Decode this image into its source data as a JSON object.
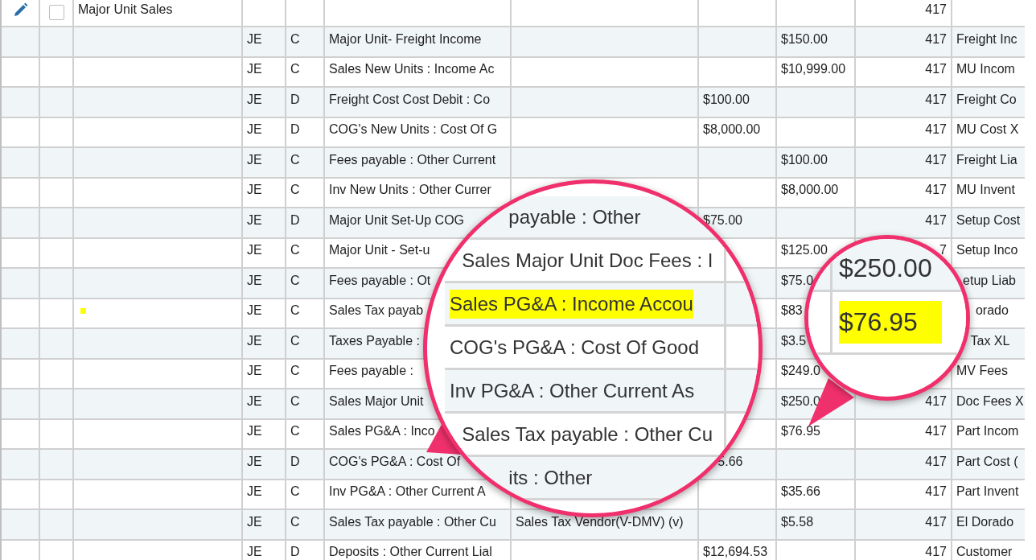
{
  "rows": [
    {
      "kind": "group",
      "name": "Major Unit Sales",
      "checked": false,
      "num": "417"
    },
    {
      "kind": "entry",
      "type": "JE",
      "dc": "C",
      "account": "Major Unit- Freight Income",
      "credit": "$150.00",
      "num": "417",
      "memo": "Freight Inc",
      "marked": false
    },
    {
      "kind": "entry",
      "type": "JE",
      "dc": "C",
      "account": "Sales New Units : Income Ac",
      "credit": "$10,999.00",
      "num": "417",
      "memo": "MU Incom",
      "marked": false
    },
    {
      "kind": "entry",
      "type": "JE",
      "dc": "D",
      "account": "Freight Cost Cost Debit : Co",
      "debit": "$100.00",
      "num": "417",
      "memo": "Freight Co",
      "marked": false
    },
    {
      "kind": "entry",
      "type": "JE",
      "dc": "D",
      "account": "COG's New Units : Cost Of G",
      "debit": "$8,000.00",
      "num": "417",
      "memo": "MU Cost X",
      "marked": false
    },
    {
      "kind": "entry",
      "type": "JE",
      "dc": "C",
      "account": "Fees payable : Other Current",
      "credit": "$100.00",
      "num": "417",
      "memo": "Freight Lia",
      "marked": false
    },
    {
      "kind": "entry",
      "type": "JE",
      "dc": "C",
      "account": "Inv New Units : Other Currer",
      "credit": "$8,000.00",
      "num": "417",
      "memo": "MU Invent",
      "marked": false
    },
    {
      "kind": "entry",
      "type": "JE",
      "dc": "D",
      "account": "Major Unit Set-Up COG",
      "debit": "$75.00",
      "num": "417",
      "memo": "Setup Cost",
      "marked": false
    },
    {
      "kind": "entry",
      "type": "JE",
      "dc": "C",
      "account": "Major Unit -  Set-u",
      "credit": "$125.00",
      "num": "7",
      "memo": "Setup Inco",
      "marked": false
    },
    {
      "kind": "entry",
      "type": "JE",
      "dc": "C",
      "account": "Fees payable : Ot",
      "credit": "$75.0",
      "memo": "etup Liab",
      "marked": false
    },
    {
      "kind": "entry",
      "type": "JE",
      "dc": "C",
      "account": "Sales Tax payab",
      "credit": "$83",
      "memo": "orado",
      "marked": true
    },
    {
      "kind": "entry",
      "type": "JE",
      "dc": "C",
      "account": "Taxes Payable :",
      "credit": "$3.5",
      "memo": "Tax XL",
      "marked": false
    },
    {
      "kind": "entry",
      "type": "JE",
      "dc": "C",
      "account": "Fees payable :",
      "credit": "$249.0",
      "memo": "MV Fees",
      "marked": false
    },
    {
      "kind": "entry",
      "type": "JE",
      "dc": "C",
      "account": "Sales Major Unit",
      "credit": "$250.0",
      "num": "417",
      "memo": "Doc Fees X",
      "marked": false
    },
    {
      "kind": "entry",
      "type": "JE",
      "dc": "C",
      "account": "Sales PG&A : Inco",
      "credit": "$76.95",
      "num": "417",
      "memo": "Part Incom",
      "marked": false
    },
    {
      "kind": "entry",
      "type": "JE",
      "dc": "D",
      "account": "COG's PG&A : Cost Of",
      "debit": "5.66",
      "num": "417",
      "memo": "Part Cost (",
      "marked": false
    },
    {
      "kind": "entry",
      "type": "JE",
      "dc": "C",
      "account": "Inv PG&A : Other Current A",
      "credit": "$35.66",
      "num": "417",
      "memo": "Part Invent",
      "marked": false
    },
    {
      "kind": "entry",
      "type": "JE",
      "dc": "C",
      "account": "Sales Tax payable : Other Cu",
      "column_7": "Sales Tax Vendor(V-DMV) (v)",
      "credit": "$5.58",
      "num": "417",
      "memo": "El Dorado",
      "marked": false
    },
    {
      "kind": "entry",
      "type": "JE",
      "dc": "D",
      "account": "Deposits : Other Current Lial",
      "debit": "$12,694.53",
      "num": "417",
      "memo": "Customer",
      "marked": false
    }
  ],
  "magnifiers": [
    {
      "rows": [
        {
          "text": "payable : Other",
          "highlighted": false
        },
        {
          "text": "Sales Major Unit Doc Fees : I",
          "highlighted": false
        },
        {
          "text": "Sales PG&A : Income Accou",
          "highlighted": true
        },
        {
          "text": "COG's PG&A : Cost Of Good",
          "highlighted": false
        },
        {
          "text": "Inv PG&A : Other Current As",
          "highlighted": false
        },
        {
          "text": "Sales Tax payable : Other Cu",
          "highlighted": false
        },
        {
          "text": "its : Other",
          "highlighted": false
        }
      ]
    },
    {
      "rows": [
        {
          "text": "$250.00",
          "highlighted": false
        },
        {
          "text": "$76.95",
          "highlighted": true
        }
      ]
    }
  ]
}
